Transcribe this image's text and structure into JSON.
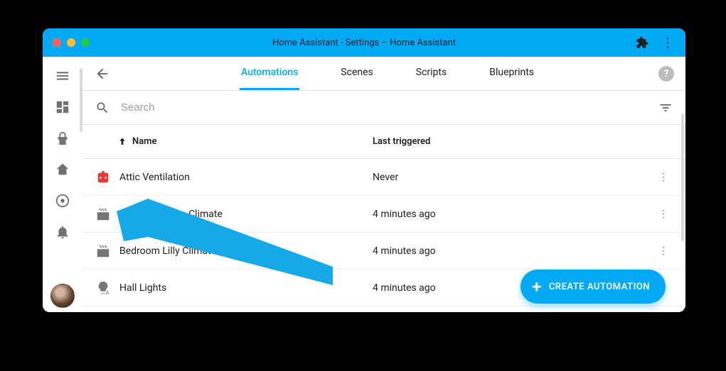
{
  "window_title": "Home Assistant - Settings – Home Assistant",
  "tabs": {
    "automations": "Automations",
    "scenes": "Scenes",
    "scripts": "Scripts",
    "blueprints": "Blueprints"
  },
  "search": {
    "placeholder": "Search"
  },
  "columns": {
    "name": "Name",
    "last": "Last triggered"
  },
  "rows": [
    {
      "icon": "robot",
      "icon_color": "#e53935",
      "name": "Attic Ventilation",
      "last": "Never"
    },
    {
      "icon": "radiator",
      "icon_color": "#757575",
      "name": "Bedroom Flynn Climate",
      "last": "4 minutes ago"
    },
    {
      "icon": "radiator",
      "icon_color": "#757575",
      "name": "Bedroom Lilly Climate",
      "last": "4 minutes ago"
    },
    {
      "icon": "lightbulb",
      "icon_color": "#757575",
      "name": "Hall Lights",
      "last": "4 minutes ago"
    }
  ],
  "fab": "CREATE AUTOMATION"
}
